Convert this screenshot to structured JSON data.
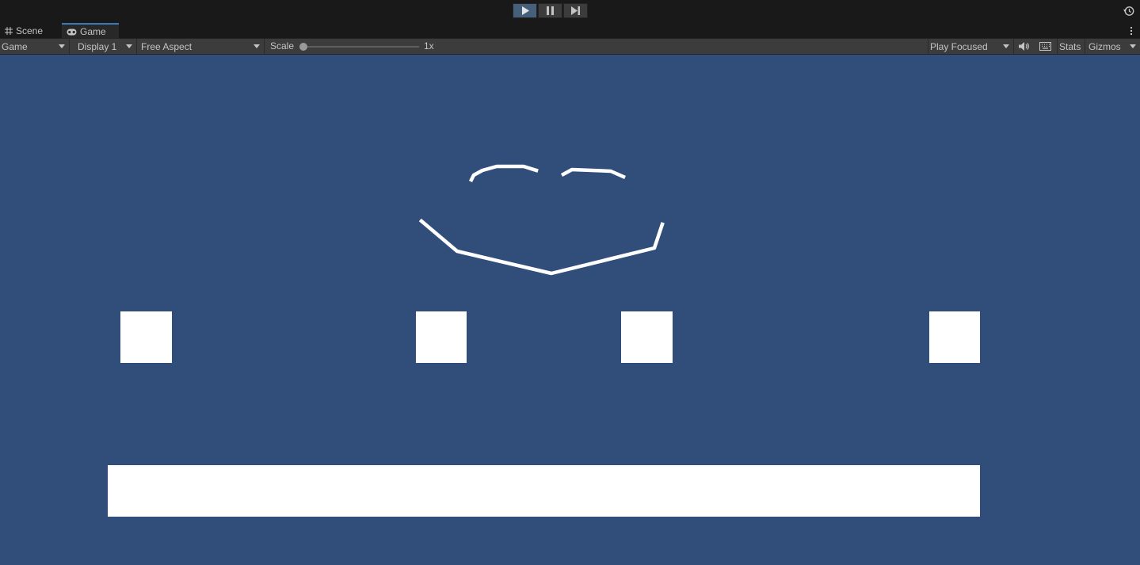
{
  "playbar": {
    "play_state": "playing",
    "buttons": [
      "play-icon",
      "pause-icon",
      "step-icon"
    ],
    "history_icon": "history-icon"
  },
  "tabs": [
    {
      "label": "Scene",
      "icon": "grid-icon",
      "active": false
    },
    {
      "label": "Game",
      "icon": "gamepad-icon",
      "active": true
    }
  ],
  "toolbar": {
    "view_select": "Game",
    "display_select": "Display 1",
    "aspect_select": "Free Aspect",
    "scale_label": "Scale",
    "scale_value": "1x",
    "scale_slider_fraction": 0.0,
    "play_mode_select": "Play Focused",
    "audio_icon": "speaker-icon",
    "keyboard_icon": "keyboard-icon",
    "stats_label": "Stats",
    "gizmos_label": "Gizmos"
  },
  "game_view": {
    "background_color": "#314d79",
    "foreground_color": "#ffffff",
    "object_count": 6
  }
}
